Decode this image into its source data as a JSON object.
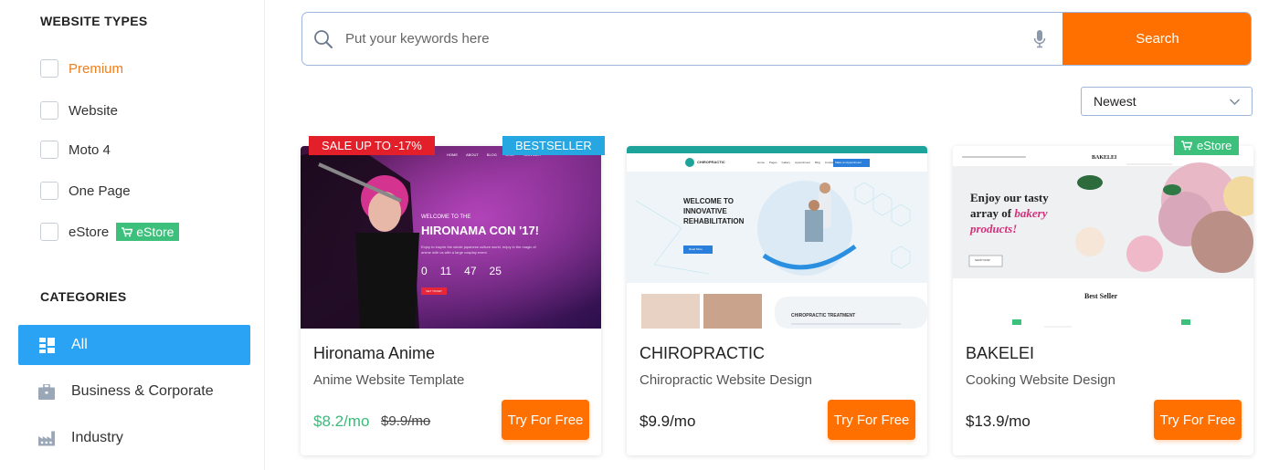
{
  "sidebar": {
    "website_types_title": "WEBSITE TYPES",
    "types": [
      {
        "label": "Premium"
      },
      {
        "label": "Website"
      },
      {
        "label": "Moto 4"
      },
      {
        "label": "One Page"
      },
      {
        "label": "eStore",
        "tag": "eStore"
      }
    ],
    "categories_title": "CATEGORIES",
    "categories": [
      {
        "label": "All",
        "icon": "grid-icon",
        "active": true
      },
      {
        "label": "Business & Corporate",
        "icon": "briefcase-icon"
      },
      {
        "label": "Industry",
        "icon": "factory-icon"
      }
    ]
  },
  "search": {
    "placeholder": "Put your keywords here",
    "button_label": "Search"
  },
  "sort": {
    "selected": "Newest"
  },
  "cards": [
    {
      "title": "Hironama Anime",
      "subtitle": "Anime Website Template",
      "price": "$8.2/mo",
      "old_price": "$9.9/mo",
      "button": "Try For Free",
      "ribbon_left": "SALE UP TO -17%",
      "ribbon_right": "BESTSELLER",
      "thumb": {
        "nav": [
          "HOME",
          "ABOUT",
          "BLOG",
          "SHOP",
          "CONTACT"
        ],
        "kicker": "WELCOME TO THE",
        "headline": "HIRONAMA CON '17!",
        "body": "Enjoy to inspire the whole japanese culture world, enjoy in the magic of\nanime with us with a large cosplay event.",
        "countdown": [
          "0",
          "11",
          "47",
          "25"
        ],
        "cta": "GET TICKET"
      }
    },
    {
      "title": "CHIROPRACTIC",
      "subtitle": "Chiropractic Website Design",
      "price": "$9.9/mo",
      "button": "Try For Free",
      "thumb": {
        "logo": "CHIROPRACTIC",
        "nav": [
          "Home",
          "Pages",
          "Gallery",
          "Appointment",
          "Blog",
          "Contacts"
        ],
        "appointment": "Make an Appointment",
        "headline": "WELCOME TO\nINNOVATIVE\nREHABILITATION",
        "cta": "Read More",
        "section": "CHIROPRACTIC TREATMENT"
      }
    },
    {
      "title": "BAKELEI",
      "subtitle": "Cooking Website Design",
      "price": "$13.9/mo",
      "button": "Try For Free",
      "ribbon_right": "eStore",
      "thumb": {
        "brand": "BAKELEI",
        "headline_1": "Enjoy our tasty",
        "headline_2": "array of",
        "headline_em": "bakery",
        "headline_3": "products!",
        "cta": "SHOP NOW",
        "section": "Best Seller"
      }
    }
  ],
  "colors": {
    "accent": "#ff7000",
    "active_blue": "#2aa3f4",
    "estore_green": "#3cc07c",
    "sale_red": "#e3202a",
    "premium_orange": "#f07e1b"
  }
}
